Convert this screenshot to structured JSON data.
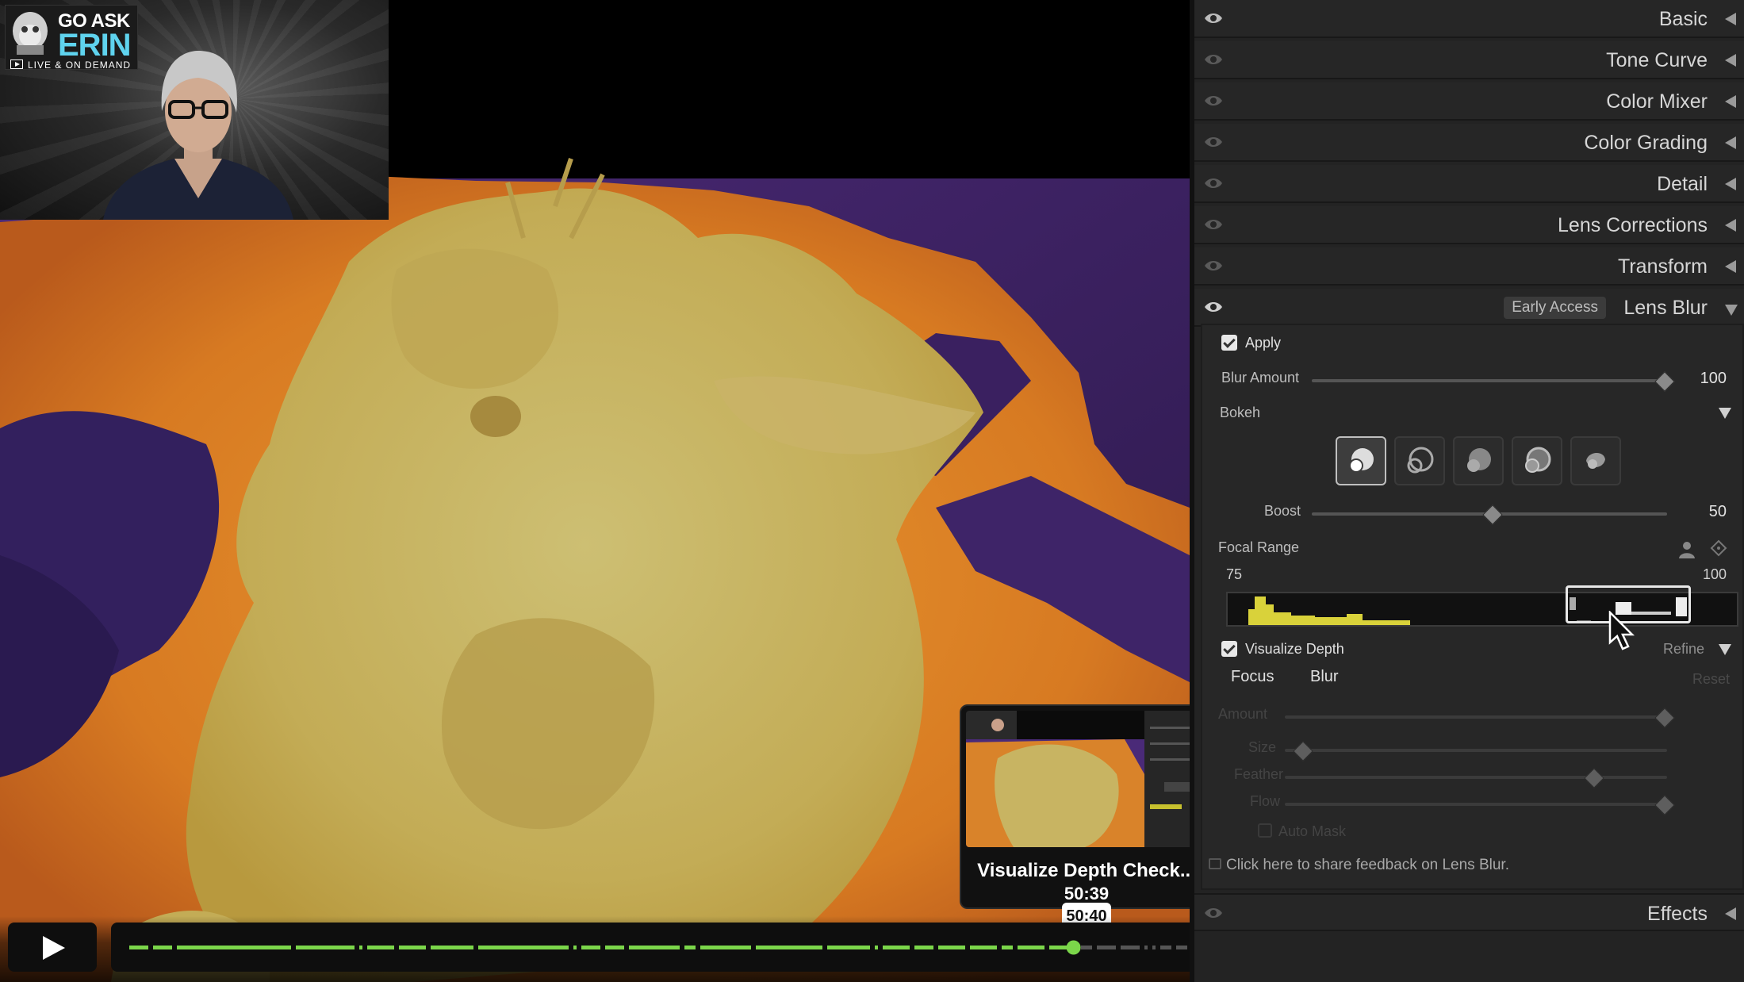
{
  "branding": {
    "line1": "GO ASK",
    "line2": "ERIN",
    "line3": "LIVE & ON DEMAND"
  },
  "panel": {
    "sections": [
      {
        "title": "Basic"
      },
      {
        "title": "Tone Curve"
      },
      {
        "title": "Color Mixer"
      },
      {
        "title": "Color Grading"
      },
      {
        "title": "Detail"
      },
      {
        "title": "Lens Corrections"
      },
      {
        "title": "Transform"
      }
    ],
    "lens_blur": {
      "title": "Lens Blur",
      "badge": "Early Access",
      "apply_label": "Apply",
      "apply_checked": true,
      "blur_amount_label": "Blur Amount",
      "blur_amount_value": "100",
      "bokeh_label": "Bokeh",
      "boost_label": "Boost",
      "boost_value": "50",
      "focal_range_label": "Focal Range",
      "focal_min": "75",
      "focal_max": "100",
      "visualize_depth_label": "Visualize Depth",
      "visualize_depth_checked": true,
      "refine_label": "Refine",
      "tab_focus": "Focus",
      "tab_blur": "Blur",
      "reset_label": "Reset",
      "refine_amount_label": "Amount",
      "refine_size_label": "Size",
      "refine_feather_label": "Feather",
      "refine_flow_label": "Flow",
      "auto_mask_label": "Auto Mask",
      "feedback_text": "Click here to share feedback on Lens Blur."
    },
    "effects_title": "Effects"
  },
  "preview": {
    "title": "Visualize Depth Check...",
    "time": "50:39"
  },
  "player": {
    "hover_time": "50:40",
    "progress": 0.746
  },
  "icons": {
    "play": "play-icon",
    "volume": "volume-icon",
    "captions": "closed-captions-icon",
    "transcript": "transcript-search-icon",
    "settings": "gear-icon",
    "chapters": "chapters-list-icon",
    "miniplayer": "miniplayer-icon",
    "fullscreen": "fullscreen-icon",
    "eye": "eye-icon"
  },
  "colors": {
    "depth_focus": "#c9b25e",
    "depth_mid": "#d9832a",
    "depth_far": "#3a2060",
    "progress_played": "#7bd64a",
    "progress_unplayed": "#555555"
  }
}
